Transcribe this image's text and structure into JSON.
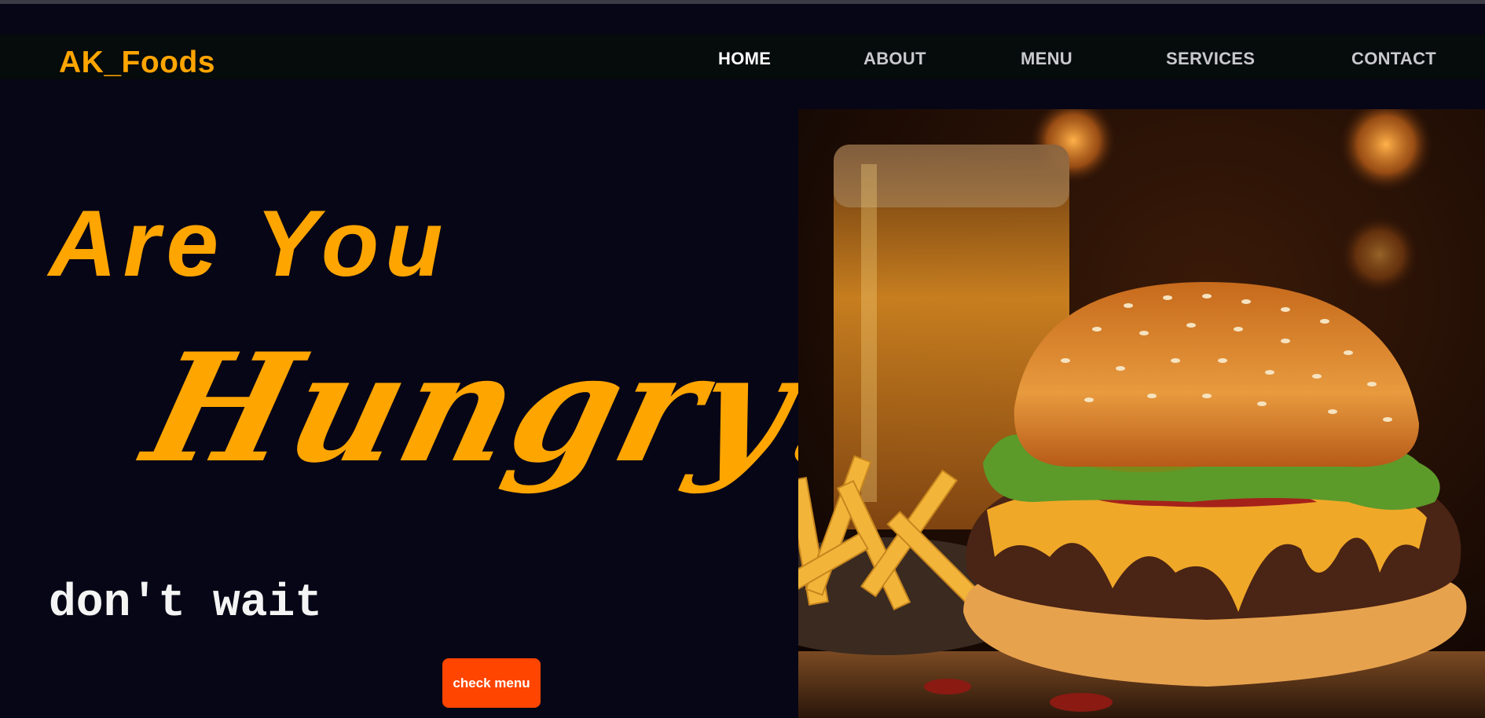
{
  "brand": {
    "name": "AK_Foods"
  },
  "nav": {
    "items": [
      {
        "label": "HOME",
        "active": true
      },
      {
        "label": "ABOUT",
        "active": false
      },
      {
        "label": "MENU",
        "active": false
      },
      {
        "label": "SERVICES",
        "active": false
      },
      {
        "label": "CONTACT",
        "active": false
      }
    ]
  },
  "hero": {
    "line1": "Are You",
    "line2": "Hungry?",
    "tagline": "don't wait",
    "cta_label": "check menu"
  },
  "image": {
    "subject": "burger-with-fries-and-drink"
  },
  "colors": {
    "background": "#070616",
    "navbar": "#060b0b",
    "accent": "#ffa500",
    "button": "#ff4500",
    "text_light": "#ffffff",
    "nav_text": "#c9c9cd"
  }
}
